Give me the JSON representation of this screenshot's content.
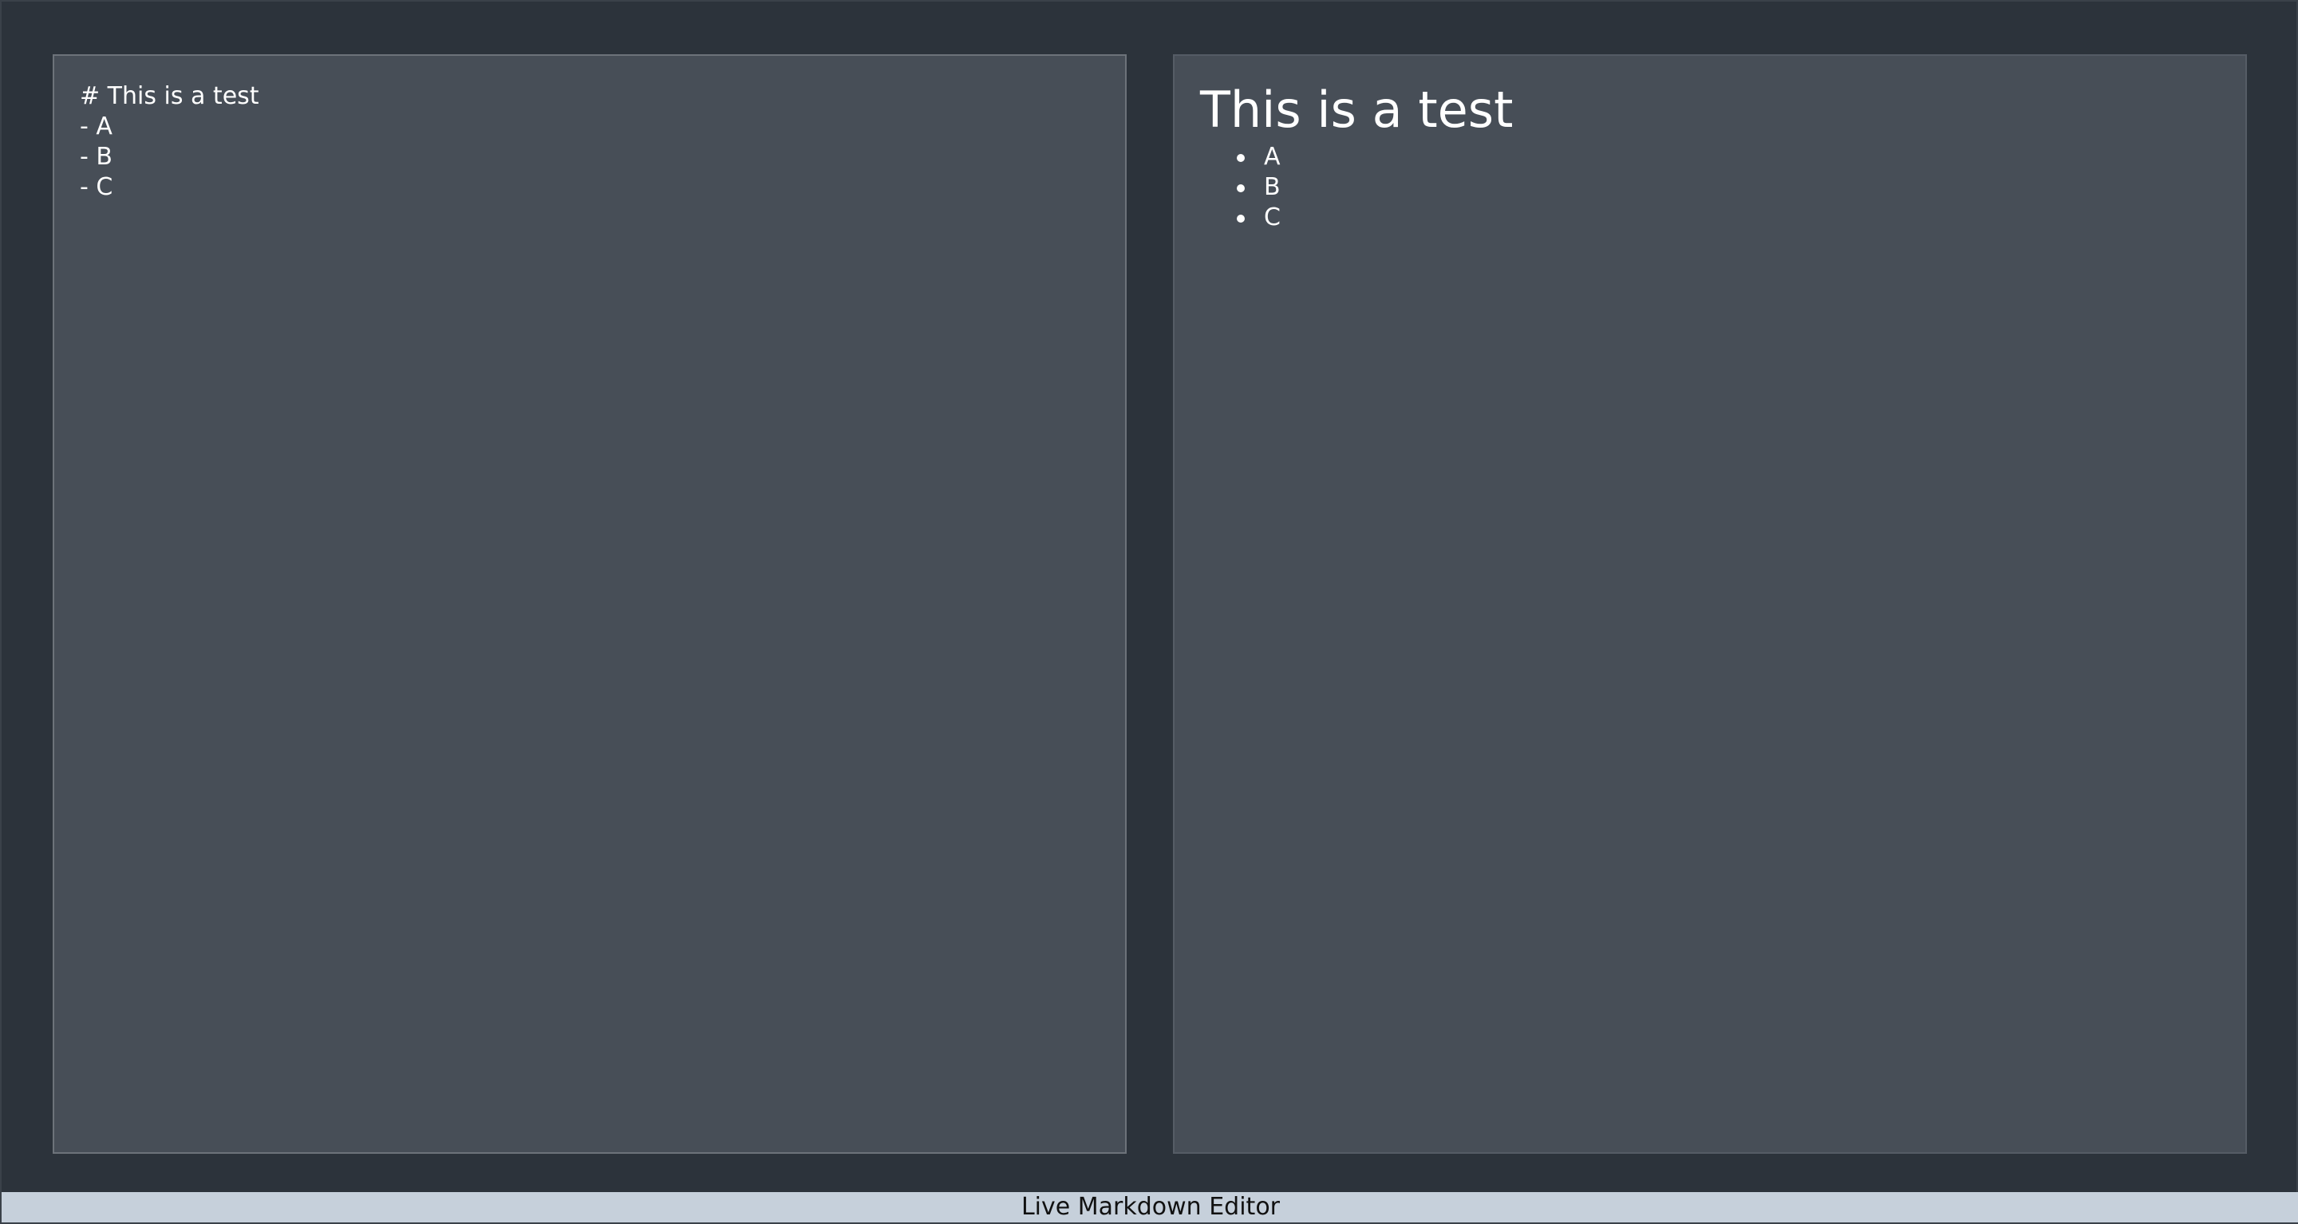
{
  "editor": {
    "text": "# This is a test\n- A\n- B\n- C"
  },
  "preview": {
    "heading": "This is a test",
    "items": [
      "A",
      "B",
      "C"
    ]
  },
  "footer": {
    "title": "Live Markdown Editor"
  }
}
